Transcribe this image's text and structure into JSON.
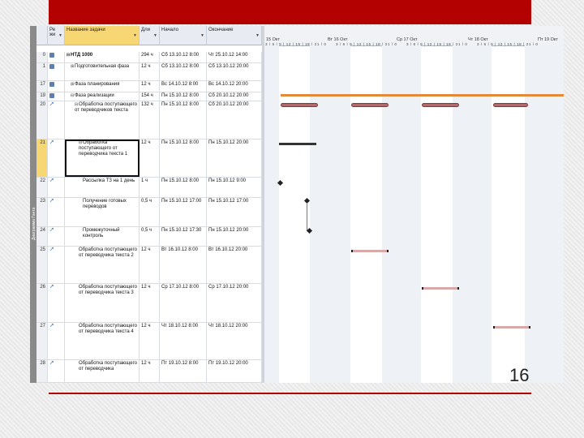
{
  "slide": {
    "number": "16",
    "accent_color": "#b30000"
  },
  "view_bar_label": "Диаграмма Ганта",
  "columns": {
    "id": "",
    "indicators": "Ре жи",
    "name": "Название задачи",
    "duration": "Дли",
    "start": "Начало",
    "finish": "Окончание"
  },
  "timescale": {
    "days": [
      "15 Окт",
      "Вт 16 Окт",
      "Ср 17 Окт",
      "Чт 18 Окт",
      "Пт 19 Окт"
    ],
    "hours": "3 | 6 | 9 | 12 | 15 | 18 | 21 | 0"
  },
  "tasks": [
    {
      "id": "0",
      "name": "НТД 1000",
      "duration": "294 ч",
      "start": "Сб 13.10.12 8:00",
      "finish": "Чт 25.10.12 14:00",
      "level": 0,
      "summary": true,
      "bold": true
    },
    {
      "id": "1",
      "name": "Подготовительная фаза",
      "duration": "12 ч",
      "start": "Сб 13.10.12 8:00",
      "finish": "Сб 13.10.12 20:00",
      "level": 1,
      "summary": true,
      "collapsed": true
    },
    {
      "id": "17",
      "name": "Фаза планирования",
      "duration": "12 ч",
      "start": "Вс 14.10.12 8:00",
      "finish": "Вс 14.10.12 20:00",
      "level": 1,
      "summary": true,
      "collapsed": true
    },
    {
      "id": "19",
      "name": "Фаза реализации",
      "duration": "154 ч",
      "start": "Пн 15.10.12 8:00",
      "finish": "Сб 20.10.12 20:00",
      "level": 1,
      "summary": true
    },
    {
      "id": "20",
      "name": "Обработка поступающего от переводчиков текста",
      "duration": "132 ч",
      "start": "Пн 15.10.12 8:00",
      "finish": "Сб 20.10.12 20:00",
      "level": 2,
      "summary": true
    },
    {
      "id": "21",
      "name": "Обработка поступающего от переводчика текста 1",
      "duration": "12 ч",
      "start": "Пн 15.10.12 8:00",
      "finish": "Пн 15.10.12 20:00",
      "level": 3,
      "summary": true,
      "selected": true
    },
    {
      "id": "22",
      "name": "Рассылка ТЗ на 1 день",
      "duration": "1 ч",
      "start": "Пн 15.10.12 8:00",
      "finish": "Пн 15.10.12 9:00",
      "level": 4
    },
    {
      "id": "23",
      "name": "Получение готовых переводов",
      "duration": "0,5 ч",
      "start": "Пн 15.10.12 17:00",
      "finish": "Пн 15.10.12 17:00",
      "level": 4
    },
    {
      "id": "24",
      "name": "Промежуточный контроль",
      "duration": "0,5 ч",
      "start": "Пн 15.10.12 17:30",
      "finish": "Пн 15.10.12 20:00",
      "level": 4
    },
    {
      "id": "25",
      "name": "Обработка поступающего от переводчика текста 2",
      "duration": "12 ч",
      "start": "Вт 16.10.12 8:00",
      "finish": "Вт 16.10.12 20:00",
      "level": 3
    },
    {
      "id": "26",
      "name": "Обработка поступающего от переводчика текста 3",
      "duration": "12 ч",
      "start": "Ср 17.10.12 8:00",
      "finish": "Ср 17.10.12 20:00",
      "level": 3
    },
    {
      "id": "27",
      "name": "Обработка поступающего от переводчика текста 4",
      "duration": "12 ч",
      "start": "Чт 18.10.12 8:00",
      "finish": "Чт 18.10.12 20:00",
      "level": 3
    },
    {
      "id": "28",
      "name": "Обработка поступающего от переводчика",
      "duration": "12 ч",
      "start": "Пт 19.10.12 8:00",
      "finish": "Пт 19.10.12 20:00",
      "level": 3
    }
  ]
}
